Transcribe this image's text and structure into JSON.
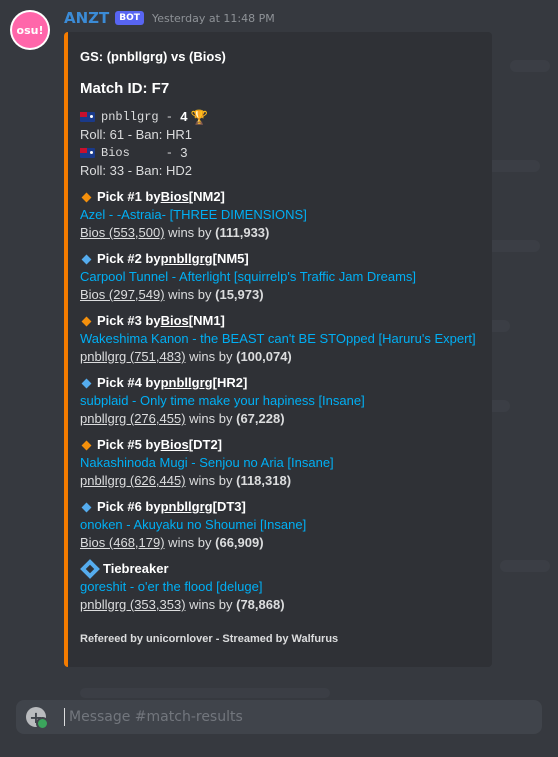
{
  "message": {
    "author": "ANZT",
    "bot_tag": "BOT",
    "timestamp": "Yesterday at 11:48 PM",
    "avatar_text": "osu!"
  },
  "embed": {
    "accent_color": "#f57c00",
    "title": "GS: (pnbllgrg) vs (Bios)",
    "match_id": "Match ID: F7",
    "players": [
      {
        "flag": "australia-flag-icon",
        "name": "pnbllgrg",
        "sep": " - ",
        "score": "4",
        "winner": true,
        "roll": "Roll: 61 - Ban: HR1"
      },
      {
        "flag": "australia-flag-icon",
        "name": "Bios    ",
        "sep": " - ",
        "score": "3",
        "winner": false,
        "roll": "Roll: 33 - Ban: HD2"
      }
    ],
    "picks": [
      {
        "icon": "orange-diamond-icon",
        "prefix": "Pick #1 by ",
        "picker": "Bios",
        "mod": " [NM2]",
        "map": "Azel - -Astraia- [THREE DIMENSIONS]",
        "winner": "Bios (553,500)",
        "wins_by": " wins by ",
        "margin": "(111,933)"
      },
      {
        "icon": "blue-diamond-icon",
        "prefix": "Pick #2 by ",
        "picker": "pnbllgrg",
        "mod": " [NM5]",
        "map": "Carpool Tunnel - Afterlight [squirrelp's Traffic Jam Dreams]",
        "winner": "Bios (297,549)",
        "wins_by": " wins by ",
        "margin": "(15,973)"
      },
      {
        "icon": "orange-diamond-icon",
        "prefix": "Pick #3 by ",
        "picker": "Bios",
        "mod": " [NM1]",
        "map": "Wakeshima Kanon - the BEAST can't BE STOpped [Haruru's Expert]",
        "winner": "pnbllgrg (751,483)",
        "wins_by": " wins by ",
        "margin": "(100,074)"
      },
      {
        "icon": "blue-diamond-icon",
        "prefix": "Pick #4 by ",
        "picker": "pnbllgrg",
        "mod": " [HR2]",
        "map": "subplaid - Only time make your hapiness [Insane]",
        "winner": "pnbllgrg (276,455)",
        "wins_by": " wins by ",
        "margin": "(67,228)"
      },
      {
        "icon": "orange-diamond-icon",
        "prefix": "Pick #5 by ",
        "picker": "Bios",
        "mod": " [DT2]",
        "map": "Nakashinoda Mugi - Senjou no Aria [Insane]",
        "winner": "pnbllgrg (626,445)",
        "wins_by": " wins by ",
        "margin": "(118,318)"
      },
      {
        "icon": "blue-diamond-icon",
        "prefix": "Pick #6 by ",
        "picker": "pnbllgrg",
        "mod": " [DT3]",
        "map": "onoken - Akuyaku no Shoumei [Insane]",
        "winner": "Bios (468,179)",
        "wins_by": " wins by ",
        "margin": "(66,909)"
      }
    ],
    "tiebreaker": {
      "icon": "tiebreaker-diamond-icon",
      "label": "Tiebreaker",
      "map": "goreshit - o'er the flood [deluge]",
      "winner": "pnbllgrg (353,353)",
      "wins_by": " wins by ",
      "margin": "(78,868)"
    },
    "footer": "Refereed by unicornlover - Streamed by Walfurus"
  },
  "composer": {
    "placeholder": "Message #match-results"
  }
}
